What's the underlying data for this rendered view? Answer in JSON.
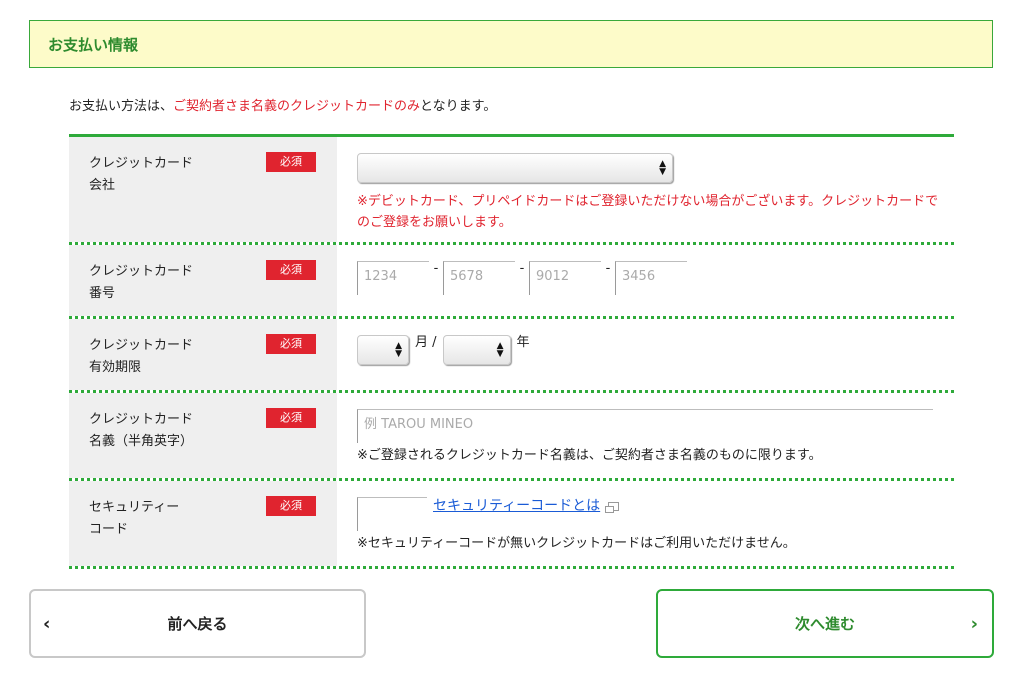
{
  "header": {
    "title": "お支払い情報"
  },
  "notice": {
    "prefix": "お支払い方法は、",
    "highlight": "ご契約者さま名義のクレジットカードのみ",
    "suffix": "となります。"
  },
  "required_label": "必須",
  "rows": {
    "company": {
      "label": "クレジットカード\n会社",
      "selected": "",
      "note": "※デビットカード、プリペイドカードはご登録いただけない場合がございます。クレジットカードでのご登録をお願いします。"
    },
    "number": {
      "label": "クレジットカード\n番号",
      "placeholders": [
        "1234",
        "5678",
        "9012",
        "3456"
      ],
      "separator": "-"
    },
    "expiry": {
      "label": "クレジットカード\n有効期限",
      "month_unit": "月 /",
      "year_unit": "年"
    },
    "name": {
      "label": "クレジットカード\n名義（半角英字）",
      "placeholder": "例 TAROU MINEO",
      "note": "※ご登録されるクレジットカード名義は、ご契約者さま名義のものに限ります。"
    },
    "security": {
      "label": "セキュリティー\nコード",
      "link": "セキュリティーコードとは",
      "note": "※セキュリティーコードが無いクレジットカードはご利用いただけません。"
    }
  },
  "buttons": {
    "back": "前へ戻る",
    "next": "次へ進む",
    "back_chevron": "‹",
    "next_chevron": "›"
  },
  "colors": {
    "accent_green": "#2eaa3a",
    "required_red": "#e0242f",
    "header_bg": "#fdfbc9",
    "link_blue": "#1a5bd6"
  }
}
